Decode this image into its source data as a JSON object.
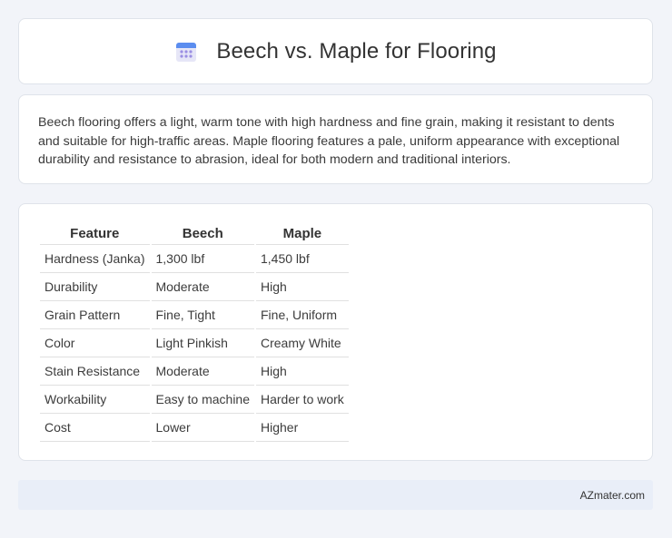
{
  "header": {
    "title": "Beech vs. Maple for Flooring",
    "icon": "calendar-icon",
    "icon_colors": {
      "top": "#5b8def",
      "body": "#e6e6f7",
      "dots": "#9b8fe3"
    }
  },
  "description": {
    "text": "Beech flooring offers a light, warm tone with high hardness and fine grain, making it resistant to dents and suitable for high-traffic areas. Maple flooring features a pale, uniform appearance with exceptional durability and resistance to abrasion, ideal for both modern and traditional interiors."
  },
  "table": {
    "headers": [
      "Feature",
      "Beech",
      "Maple"
    ],
    "rows": [
      [
        "Hardness (Janka)",
        "1,300 lbf",
        "1,450 lbf"
      ],
      [
        "Durability",
        "Moderate",
        "High"
      ],
      [
        "Grain Pattern",
        "Fine, Tight",
        "Fine, Uniform"
      ],
      [
        "Color",
        "Light Pinkish",
        "Creamy White"
      ],
      [
        "Stain Resistance",
        "Moderate",
        "High"
      ],
      [
        "Workability",
        "Easy to machine",
        "Harder to work"
      ],
      [
        "Cost",
        "Lower",
        "Higher"
      ]
    ]
  },
  "footer": {
    "text": "AZmater.com"
  }
}
